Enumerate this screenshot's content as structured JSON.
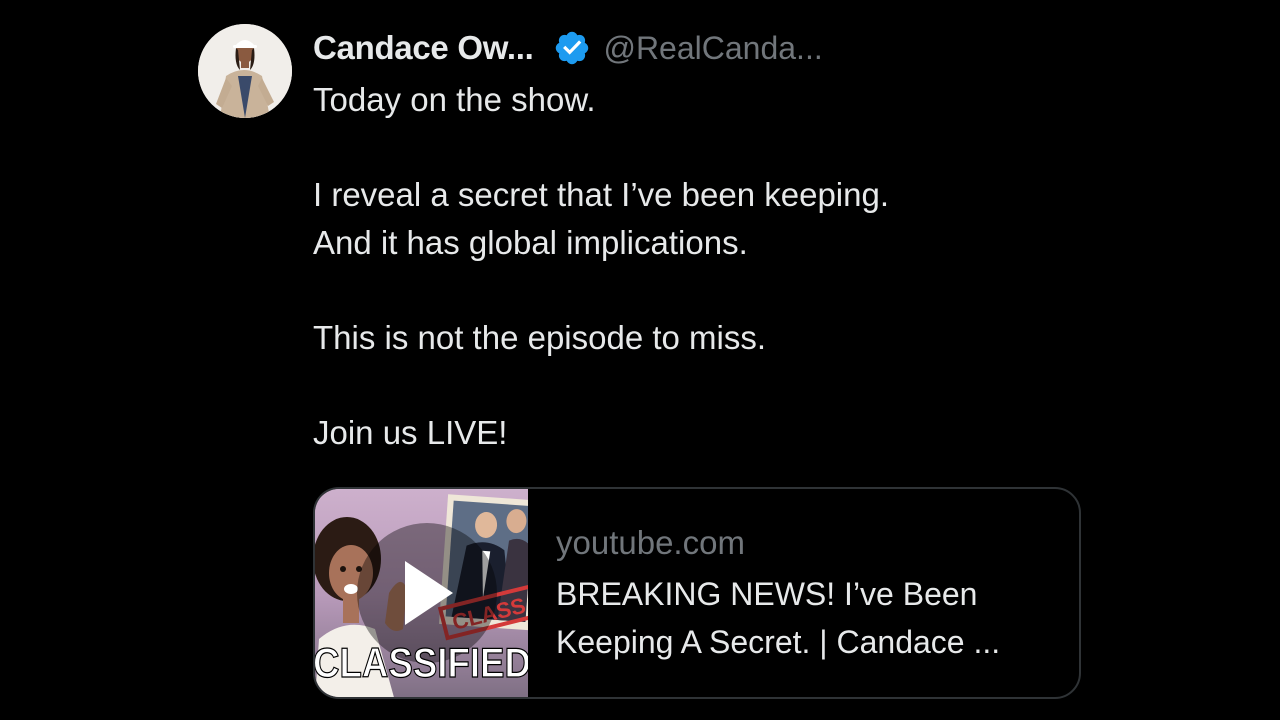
{
  "tweet": {
    "author": {
      "display_name": "Candace Ow...",
      "handle": "@RealCanda...",
      "verified": true,
      "verified_icon": "verified-badge-icon",
      "verified_color": "#1d9bf0"
    },
    "text": "Today on the show.\n\nI reveal a secret that I’ve been keeping.\nAnd it has global implications.\n\nThis is not the episode to miss.\n\nJoin us LIVE!",
    "link_card": {
      "domain": "youtube.com",
      "title": "BREAKING NEWS! I’ve Been Keeping A Secret. | Candace ...",
      "thumbnail": {
        "banner_text": "CLASSIFIED",
        "stamp_text": "CLASS",
        "play_icon": "play-icon"
      }
    }
  },
  "colors": {
    "background": "#000000",
    "text_primary": "#e7e9ea",
    "text_secondary": "#71767b",
    "border": "#2f3336",
    "accent": "#1d9bf0"
  }
}
